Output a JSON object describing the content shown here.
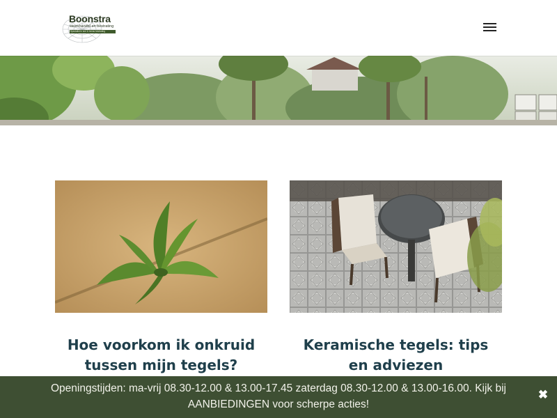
{
  "header": {
    "logo": {
      "brand": "Boonstra",
      "subtitle": "steenhandel en bestrating",
      "tagline": "Specialist in sier & terras bestrating"
    },
    "menu_icon": "hamburger-menu-icon"
  },
  "hero": {
    "image": "garden-plants-photo"
  },
  "posts": [
    {
      "title": "Hoe voorkom ik onkruid tussen mijn tegels?",
      "image": "weed-between-tiles-photo"
    },
    {
      "title": "Keramische tegels: tips en adviezen",
      "image": "ceramic-tiles-terrace-photo"
    }
  ],
  "notice": {
    "text": "Openingstijden: ma-vrij 08.30-12.00 & 13.00-17.45 zaterdag 08.30-12.00 & 13.00-16.00. Kijk bij AANBIEDINGEN voor scherpe acties!",
    "close_icon": "close-x-icon"
  },
  "colors": {
    "notice_bg": "#3e4f33",
    "title_color": "#1f3f4b",
    "logo_green": "#3f5a2c"
  }
}
